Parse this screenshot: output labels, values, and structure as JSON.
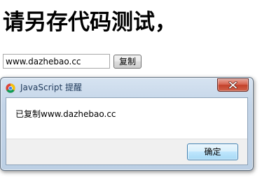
{
  "page": {
    "title": "请另存代码测试，"
  },
  "form": {
    "input_value": "www.dazhebao.cc",
    "copy_button_label": "复制"
  },
  "dialog": {
    "title": "JavaScript 提醒",
    "message": "已复制www.dazhebao.cc",
    "ok_label": "确定",
    "icons": {
      "app": "chrome-icon",
      "close": "close-icon"
    }
  },
  "colors": {
    "close_button": "#c3412b",
    "dialog_frame": "#bccfe4",
    "ok_button_border": "#3c7fb1"
  }
}
